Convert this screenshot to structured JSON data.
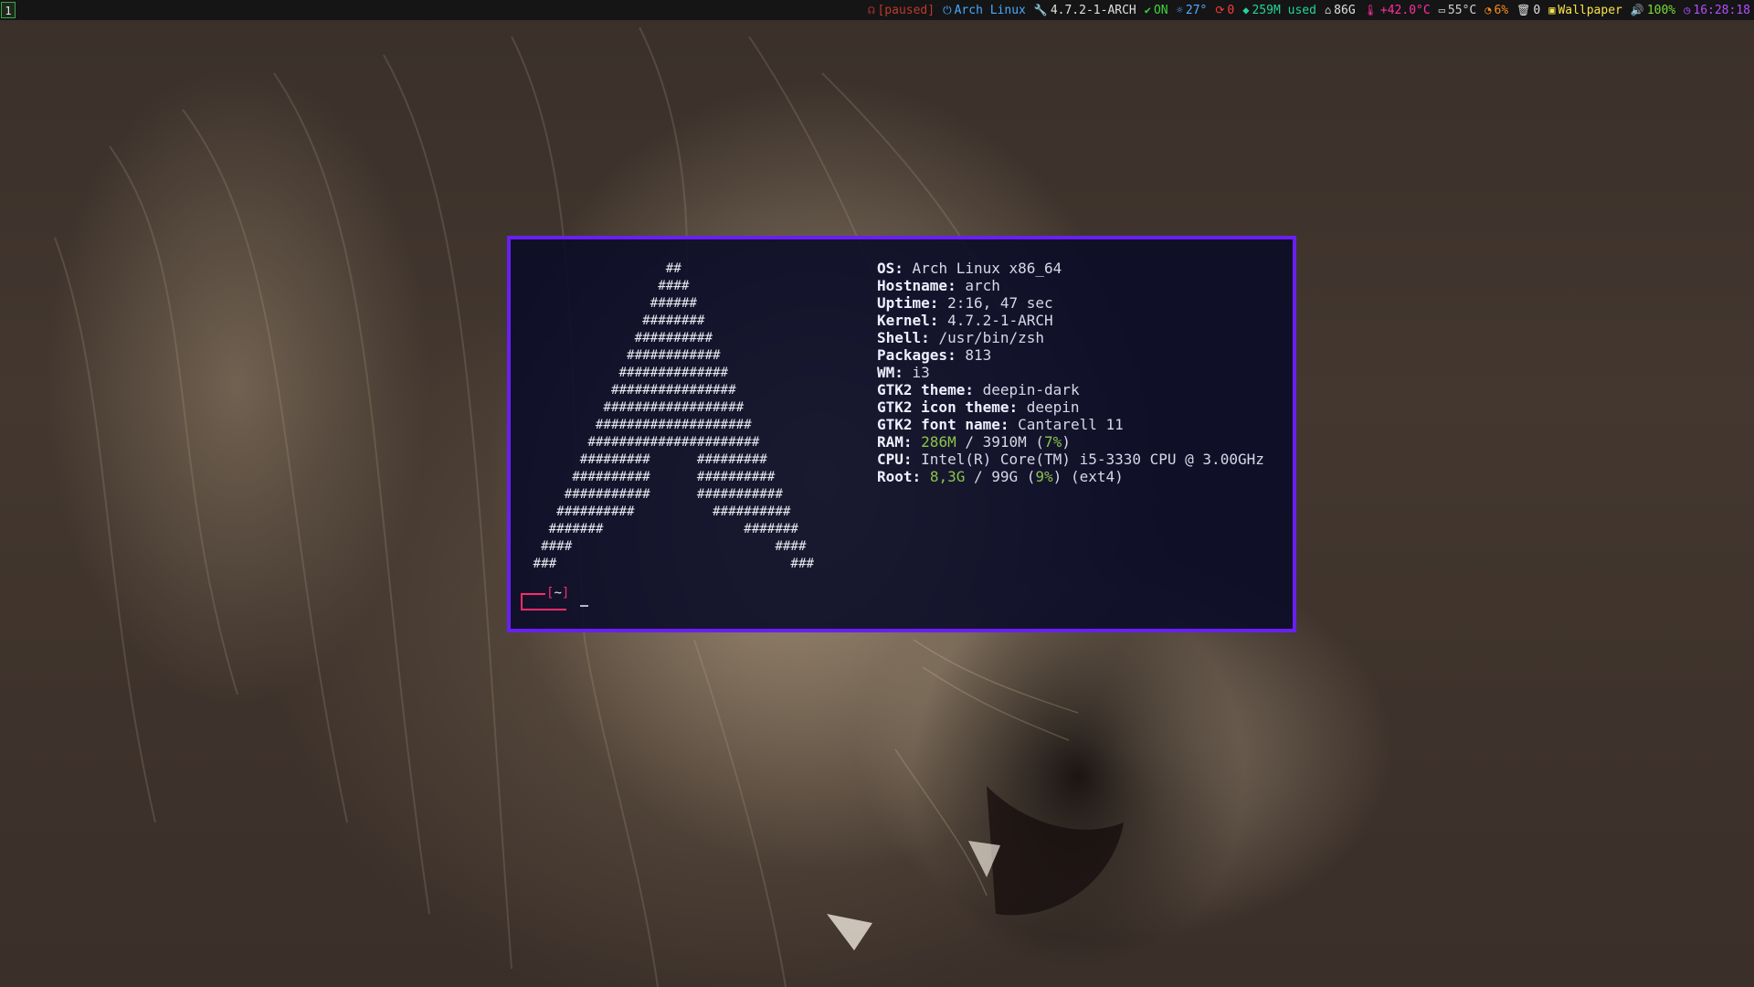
{
  "bar": {
    "workspace": "1",
    "items": [
      {
        "icon": "headphones-icon",
        "glyph": "☊",
        "text": "[paused]",
        "color": "#c0392b"
      },
      {
        "icon": "arch-logo-icon",
        "glyph": "⏻",
        "text": "Arch Linux",
        "color": "#4aa8ff"
      },
      {
        "icon": "wrench-icon",
        "glyph": "🔧",
        "text": "4.7.2-1-ARCH",
        "color": "#e0e0e0"
      },
      {
        "icon": "network-check-icon",
        "glyph": "✔",
        "text": "ON",
        "color": "#3fd43f"
      },
      {
        "icon": "sun-icon",
        "glyph": "☼",
        "text": "27°",
        "color": "#5aa8ff"
      },
      {
        "icon": "refresh-icon",
        "glyph": "⟳",
        "text": "0",
        "color": "#ff3b3b"
      },
      {
        "icon": "memory-icon",
        "glyph": "◆",
        "text": "259M used",
        "color": "#25d39a"
      },
      {
        "icon": "home-icon",
        "glyph": "⌂",
        "text": "86G",
        "color": "#e0e0e0"
      },
      {
        "icon": "thermometer-icon",
        "glyph": "🌡",
        "text": "+42.0°C",
        "color": "#ff2fa0"
      },
      {
        "icon": "monitor-icon",
        "glyph": "▭",
        "text": "55°C",
        "color": "#d0d0d0"
      },
      {
        "icon": "gauge-icon",
        "glyph": "◔",
        "text": "6%",
        "color": "#ff8c1a"
      },
      {
        "icon": "trash-icon",
        "glyph": "🗑",
        "text": "0",
        "color": "#e0e0e0"
      },
      {
        "icon": "image-icon",
        "glyph": "▣",
        "text": "Wallpaper",
        "color": "#f7e24a"
      },
      {
        "icon": "volume-icon",
        "glyph": "🔊",
        "text": "100%",
        "color": "#7ddc3a"
      },
      {
        "icon": "clock-icon",
        "glyph": "◷",
        "text": "16:28:18",
        "color": "#b44dff"
      }
    ]
  },
  "terminal": {
    "ascii_art": "                  ##\n                 ####\n                ######\n               ########\n              ##########\n             ############\n            ##############\n           ################\n          ##################\n         ####################\n        ######################\n       #########      #########\n      ##########      ##########\n     ###########      ###########\n    ##########          ##########\n   #######                  #######\n  ####                          ####\n ###                              ###",
    "info": [
      {
        "key": "OS:",
        "value": "Arch Linux x86_64"
      },
      {
        "key": "Hostname:",
        "value": "arch"
      },
      {
        "key": "Uptime:",
        "value": "2:16, 47 sec"
      },
      {
        "key": "Kernel:",
        "value": "4.7.2-1-ARCH"
      },
      {
        "key": "Shell:",
        "value": "/usr/bin/zsh"
      },
      {
        "key": "Packages:",
        "value": "813"
      },
      {
        "key": "WM:",
        "value": "i3"
      },
      {
        "key": "GTK2 theme:",
        "value": "deepin-dark"
      },
      {
        "key": "GTK2 icon theme:",
        "value": "deepin"
      },
      {
        "key": "GTK2 font name:",
        "value": "Cantarell 11"
      },
      {
        "key": "RAM:",
        "parts": [
          {
            "t": "286M",
            "c": "g"
          },
          {
            "t": " / 3910M ("
          },
          {
            "t": "7%",
            "c": "g"
          },
          {
            "t": ")"
          }
        ]
      },
      {
        "key": "CPU:",
        "value": "Intel(R) Core(TM) i5-3330 CPU @ 3.00GHz"
      },
      {
        "key": "Root:",
        "parts": [
          {
            "t": "8,3G",
            "c": "g"
          },
          {
            "t": " / 99G ("
          },
          {
            "t": "9%",
            "c": "g"
          },
          {
            "t": ") (ext4)"
          }
        ]
      }
    ],
    "prompt": {
      "open": "[",
      "dir": "~",
      "close": "]"
    }
  },
  "colors": {
    "border": "#6a1ff2",
    "prompt": "#ff2a6a",
    "good": "#8bc34a"
  }
}
